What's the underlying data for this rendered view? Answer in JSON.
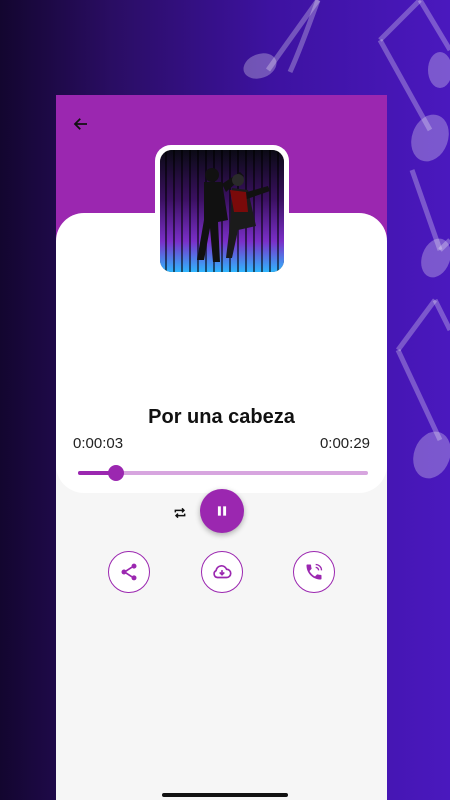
{
  "song": {
    "title": "Por una cabeza",
    "elapsed": "0:00:03",
    "duration": "0:00:29",
    "progress": 0.13
  },
  "icons": {
    "back": "arrow-left-icon",
    "repeat": "repeat-icon",
    "pause": "pause-icon",
    "share": "share-icon",
    "download": "cloud-download-icon",
    "ringtone": "phone-ringtone-icon"
  },
  "colors": {
    "accent": "#9b27b0",
    "accent_light": "#d7a5df",
    "card": "#ffffff"
  }
}
